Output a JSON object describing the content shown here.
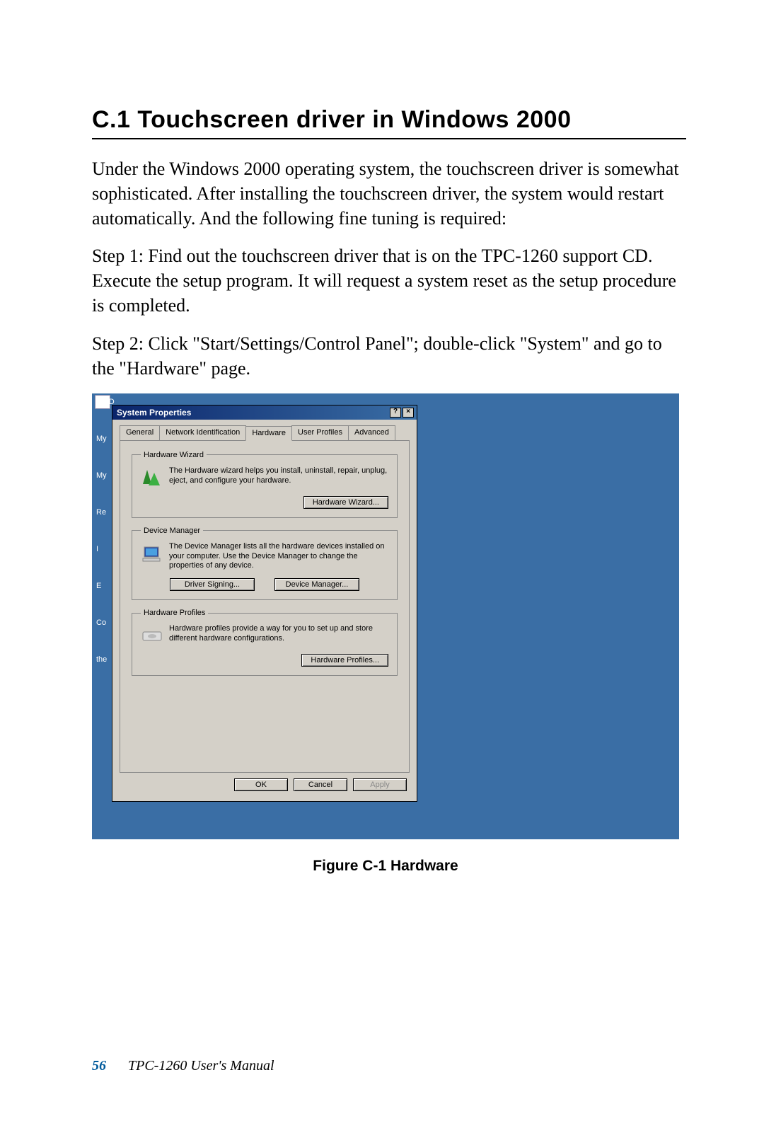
{
  "heading": "C.1   Touchscreen driver in Windows 2000",
  "para_intro": "Under the Windows 2000 operating system, the touchscreen driver is somewhat sophisticated. After installing the touchscreen driver, the system would restart automatically. And the following fine tuning is required:",
  "para_step1": "Step 1:       Find out the touchscreen driver that is on the TPC-1260 support CD. Execute the setup program. It will request a system reset as the setup procedure is completed.",
  "para_step2": "Step 2:       Click \"Start/Settings/Control Panel\"; double-click \"System\" and go to the \"Hardware\" page.",
  "figure_caption": "Figure C-1 Hardware",
  "footer": {
    "page": "56",
    "title": "TPC-1260  User's Manual"
  },
  "desktop": {
    "icons": [
      "My D",
      "My",
      "My",
      "Re",
      "I",
      "E",
      "Co",
      "the"
    ]
  },
  "dialog": {
    "title": "System Properties",
    "help": "?",
    "close": "×",
    "tabs": [
      "General",
      "Network Identification",
      "Hardware",
      "User Profiles",
      "Advanced"
    ],
    "active_tab_index": 2,
    "groups": {
      "hw_wizard": {
        "legend": "Hardware Wizard",
        "text": "The Hardware wizard helps you install, uninstall, repair, unplug, eject, and configure your hardware.",
        "button": "Hardware Wizard..."
      },
      "dev_mgr": {
        "legend": "Device Manager",
        "text": "The Device Manager lists all the hardware devices installed on your computer. Use the Device Manager to change the properties of any device.",
        "button_left": "Driver Signing...",
        "button_right": "Device Manager..."
      },
      "hw_profiles": {
        "legend": "Hardware Profiles",
        "text": "Hardware profiles provide a way for you to set up and store different hardware configurations.",
        "button": "Hardware Profiles..."
      }
    },
    "actions": {
      "ok": "OK",
      "cancel": "Cancel",
      "apply": "Apply"
    }
  }
}
